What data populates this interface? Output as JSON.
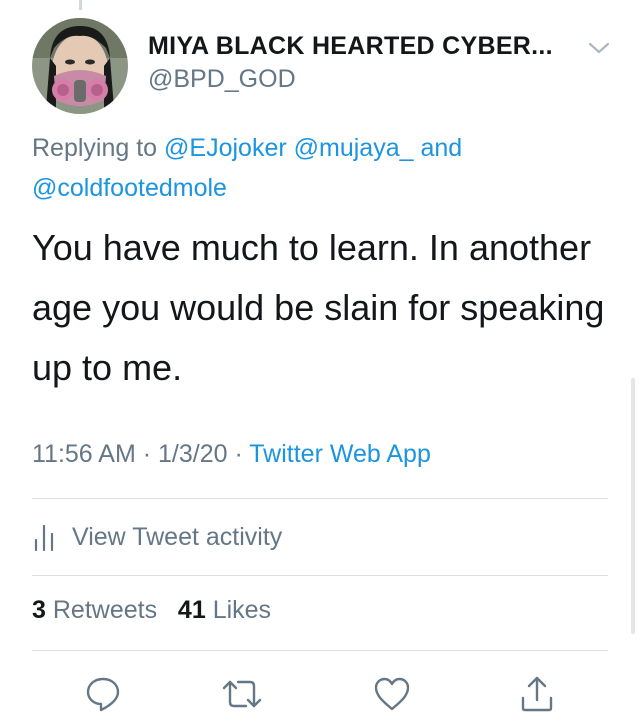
{
  "author": {
    "display_name": "MIYA BLACK HEARTED CYBER...",
    "handle": "@BPD_GOD"
  },
  "reply": {
    "prefix": "Replying to",
    "mention_1": "@EJojoker",
    "mention_2": "@mujaya_",
    "conjunction": "and",
    "mention_3": "@coldfootedmole"
  },
  "tweet": {
    "text": "You have much to learn. In another age you would be slain for speaking up to me."
  },
  "meta": {
    "time": "11:56 AM",
    "separator_1": " · ",
    "date": "1/3/20",
    "separator_2": " · ",
    "source": "Twitter Web App"
  },
  "activity": {
    "label": "View Tweet activity"
  },
  "stats": {
    "retweets_count": "3",
    "retweets_label": "Retweets",
    "likes_count": "41",
    "likes_label": "Likes"
  },
  "icons": {
    "reply": "reply-icon",
    "retweet": "retweet-icon",
    "like": "heart-icon",
    "share": "share-icon",
    "activity": "bar-chart-icon",
    "menu": "chevron-down-icon"
  },
  "colors": {
    "link": "#1b95e0",
    "secondary_text": "#657786",
    "primary_text": "#14171a",
    "divider": "#d8dee3"
  }
}
